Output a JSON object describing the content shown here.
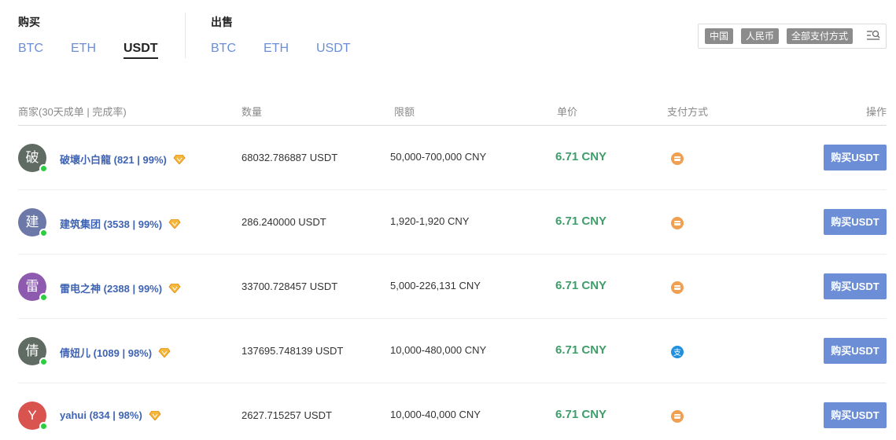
{
  "buy": {
    "title": "购买",
    "tabs": [
      "BTC",
      "ETH",
      "USDT"
    ],
    "active": 2
  },
  "sell": {
    "title": "出售",
    "tabs": [
      "BTC",
      "ETH",
      "USDT"
    ]
  },
  "filters": {
    "chips": [
      "中国",
      "人民币",
      "全部支付方式"
    ],
    "icon": "filter-search-icon"
  },
  "table": {
    "headers": {
      "merchant": "商家(30天成单 | 完成率)",
      "quantity": "数量",
      "limit": "限额",
      "price": "单价",
      "payment": "支付方式",
      "action": "操作"
    },
    "rows": [
      {
        "avatar": "破",
        "avatar_color": "#5f6b63",
        "merchant": "破壞小白龍 (821 | 99%)",
        "quantity": "68032.786887 USDT",
        "limit": "50,000-700,000 CNY",
        "price": "6.71 CNY",
        "payment_icon": "bank-card-icon",
        "button": "购买USDT"
      },
      {
        "avatar": "建",
        "avatar_color": "#6b78a8",
        "merchant": "建筑集团 (3538 | 99%)",
        "quantity": "286.240000 USDT",
        "limit": "1,920-1,920 CNY",
        "price": "6.71 CNY",
        "payment_icon": "bank-card-icon",
        "button": "购买USDT"
      },
      {
        "avatar": "雷",
        "avatar_color": "#8e5ab0",
        "merchant": "雷电之神 (2388 | 99%)",
        "quantity": "33700.728457 USDT",
        "limit": "5,000-226,131 CNY",
        "price": "6.71 CNY",
        "payment_icon": "bank-card-icon",
        "button": "购买USDT"
      },
      {
        "avatar": "倩",
        "avatar_color": "#5f6b63",
        "merchant": "倩妞儿 (1089 | 98%)",
        "quantity": "137695.748139 USDT",
        "limit": "10,000-480,000 CNY",
        "price": "6.71 CNY",
        "payment_icon": "alipay-icon",
        "button": "购买USDT"
      },
      {
        "avatar": "Y",
        "avatar_color": "#d9534f",
        "merchant": "yahui (834 | 98%)",
        "quantity": "2627.715257 USDT",
        "limit": "10,000-40,000 CNY",
        "price": "6.71 CNY",
        "payment_icon": "bank-card-icon",
        "button": "购买USDT"
      }
    ]
  },
  "colors": {
    "accent": "#6b8ed6",
    "price": "#3f9d6a",
    "merchant": "#3f63b3",
    "online": "#2ecc40",
    "badge": "#f0a020"
  }
}
